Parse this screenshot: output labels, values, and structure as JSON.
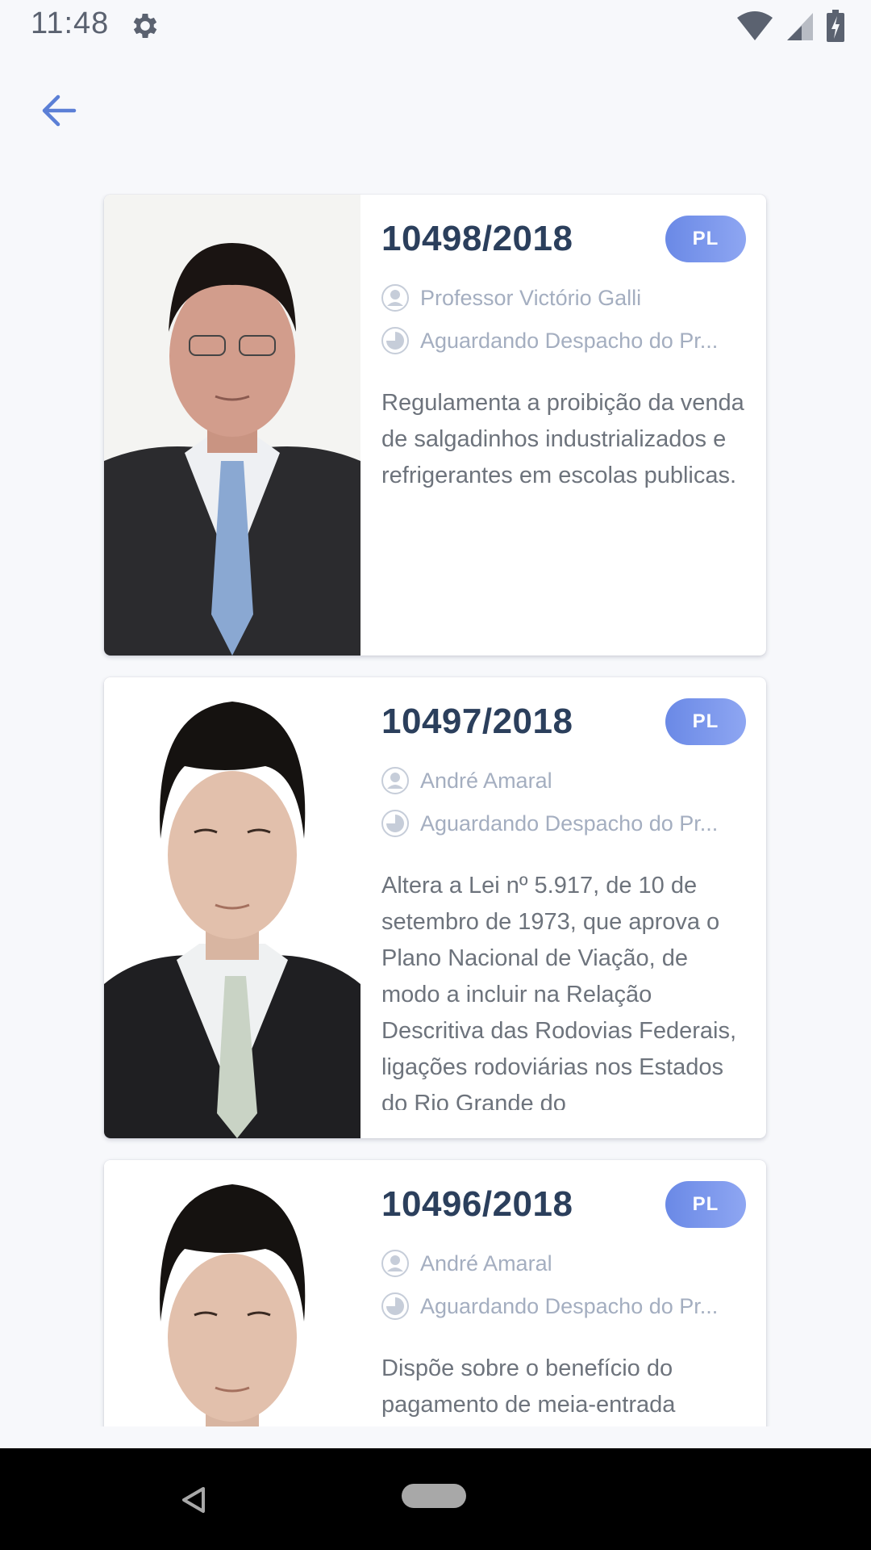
{
  "status_bar": {
    "time": "11:48"
  },
  "colors": {
    "accent": "#5b7fd6",
    "badge_start": "#6a89e6",
    "badge_end": "#8ea6f2",
    "title": "#2b3f5c",
    "meta": "#a4aec0"
  },
  "cards": [
    {
      "number": "10498/2018",
      "badge": "PL",
      "author": "Professor Victório Galli",
      "status": "Aguardando Despacho do Pr...",
      "description": "Regulamenta a proibição da venda de salgadinhos industrializados e refrigerantes em escolas publicas."
    },
    {
      "number": "10497/2018",
      "badge": "PL",
      "author": "André Amaral",
      "status": "Aguardando Despacho do Pr...",
      "description": "Altera a Lei nº 5.917, de 10 de setembro de 1973, que aprova o Plano Nacional de Viação, de modo a incluir na Relação Descritiva das Rodovias Federais, ligações rodoviárias nos Estados do Rio Grande do"
    },
    {
      "number": "10496/2018",
      "badge": "PL",
      "author": "André Amaral",
      "status": "Aguardando Despacho do Pr...",
      "description": "Dispõe sobre o benefício do pagamento de meia-entrada"
    }
  ],
  "icons": {
    "status": [
      "gear-icon",
      "wifi-icon",
      "signal-icon",
      "battery-icon"
    ],
    "back": "arrow-left-icon",
    "author": "user-icon",
    "status_meta": "clock-icon",
    "nav": [
      "nav-back-icon",
      "nav-home-pill"
    ]
  }
}
